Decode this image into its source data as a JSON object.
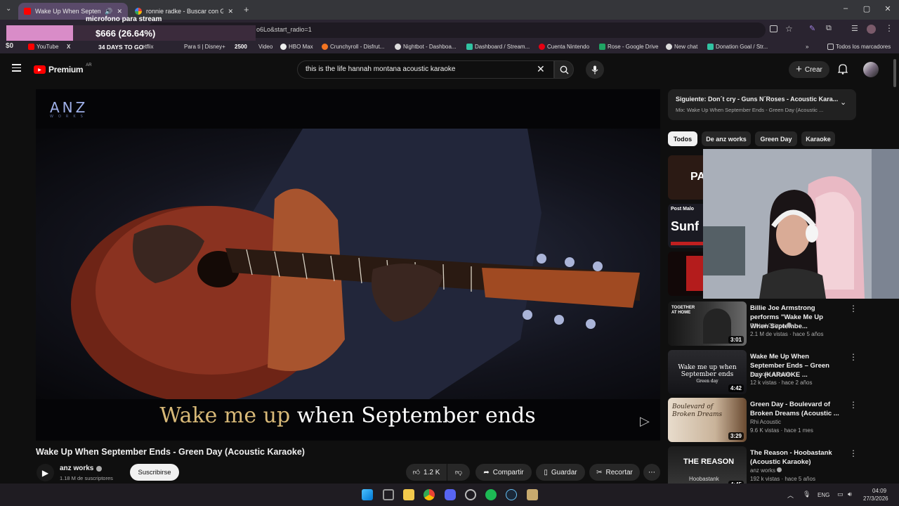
{
  "browser": {
    "tabs": [
      {
        "title": "Wake Up When September",
        "active": true
      },
      {
        "title": "ronnie radke - Buscar con Goo",
        "active": false
      }
    ],
    "url": "o6Lo&start_radio=1"
  },
  "stream_overlay": {
    "mic_label": "microfono para stream",
    "donation_goal": "$666 (26.64%)",
    "counter_left": "$0",
    "days_to_go": "34 DAYS TO GO",
    "points": "2500"
  },
  "bookmarks": [
    {
      "label": "YouTube",
      "color": "#ff0000"
    },
    {
      "label": "etflix",
      "color": "#e50914"
    },
    {
      "label": "Para ti | Disney+",
      "color": "#113ccf"
    },
    {
      "label": "Video",
      "color": "#00a8e1"
    },
    {
      "label": "HBO Max",
      "color": "#5822b4"
    },
    {
      "label": "Crunchyroll - Disfrut...",
      "color": "#f47521"
    },
    {
      "label": "Nightbot - Dashboa...",
      "color": "#ffffff"
    },
    {
      "label": "Dashboard / Stream...",
      "color": "#31c3a2"
    },
    {
      "label": "Cuenta Nintendo",
      "color": "#e60012"
    },
    {
      "label": "Rose - Google Drive",
      "color": "#1fa463"
    },
    {
      "label": "New chat",
      "color": "#10a37f"
    },
    {
      "label": "Donation Goal / Str...",
      "color": "#31c3a2"
    }
  ],
  "bookmarks_all": "Todos los marcadores",
  "youtube": {
    "logo": "Premium",
    "region": "AR",
    "search_query": "this is the life hannah montana acoustic karaoke",
    "create_label": "Crear"
  },
  "video": {
    "watermark": "ANZ",
    "watermark_sub": "WORKS",
    "lyric_sung": "Wake me up",
    "lyric_rest": " when September ends",
    "title": "Wake Up When September Ends - Green Day (Acoustic Karaoke)",
    "channel": "anz works",
    "subscribers": "1.18 M de suscriptores",
    "subscribe_label": "Suscribirse",
    "likes": "1.2 K",
    "share_label": "Compartir",
    "save_label": "Guardar",
    "clip_label": "Recortar"
  },
  "up_next": {
    "title": "Siguiente: Don´t cry - Guns N´Roses - Acoustic Kara...",
    "subtitle": "Mix: Wake Up When September Ends - Green Day (Acoustic ..."
  },
  "chips": [
    "Todos",
    "De anz works",
    "Green Day",
    "Karaoke"
  ],
  "recommendations": [
    {
      "title": "Billie Joe Armstrong performs \"Wake Me Up When Septembe...",
      "channel": "Global Citizen",
      "meta": "2.1 M de vistas · hace 5 años",
      "duration": "3:01",
      "verified": true
    },
    {
      "title": "Wake Me Up When September Ends – Green Day (KARAOKE ...",
      "channel": "Karaoke Akustik",
      "meta": "12 k vistas · hace 2 años",
      "duration": "4:42",
      "verified": false
    },
    {
      "title": "Green Day - Boulevard of Broken Dreams (Acoustic ...",
      "channel": "Rhi Acoustic",
      "meta": "9.6 K vistas · hace 1 mes",
      "duration": "3:29",
      "verified": false
    },
    {
      "title": "The Reason - Hoobastank (Acoustic Karaoke)",
      "channel": "anz works",
      "meta": "192 k vistas · hace 5 años",
      "duration": "4:45",
      "verified": true
    }
  ],
  "thumb_text": {
    "r1": "TOGETHER AT HOME",
    "r2a": "Wake me up when",
    "r2b": "September ends",
    "r2c": "Green day",
    "r3a": "Boulevard of",
    "r3b": "Broken Dreams",
    "r4": "THE REASON",
    "r4b": "Hoobastank",
    "partial1": "PA",
    "partial2": "Sunf",
    "partial2b": "Post Malo"
  },
  "taskbar": {
    "lang": "ENG",
    "time": "04:09",
    "date": "27/3/2026"
  }
}
